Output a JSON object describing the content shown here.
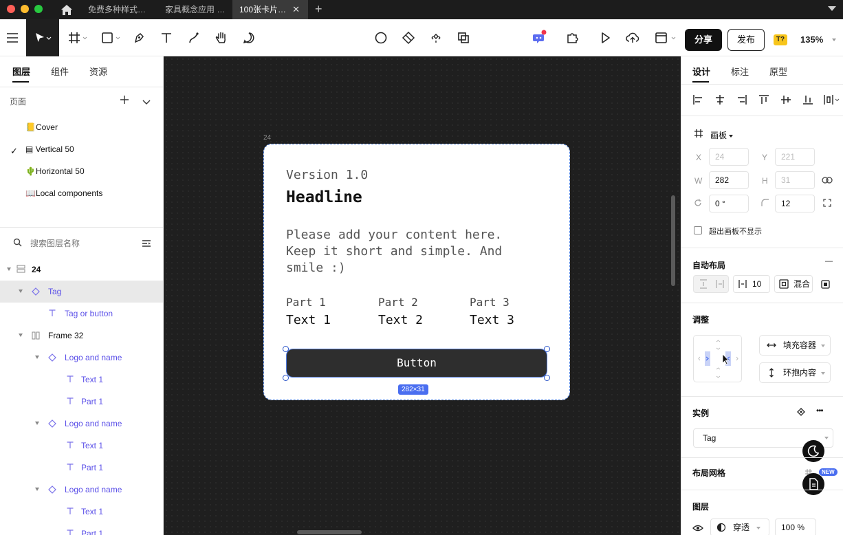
{
  "titlebar": {
    "tabs": [
      {
        "label": "免费多种样式…"
      },
      {
        "label": "家具概念应用 …"
      },
      {
        "label": "100张卡片…"
      }
    ],
    "close": "✕",
    "new_tab": "+"
  },
  "toolbar": {
    "share_label": "分享",
    "publish_label": "发布",
    "font_badge": "T?",
    "zoom": "135%"
  },
  "left": {
    "tabs": [
      "图层",
      "组件",
      "资源"
    ],
    "pages_label": "页面",
    "pages": [
      {
        "label": "📒Cover"
      },
      {
        "label": "▤ Vertical 50"
      },
      {
        "label": "🌵Horizontal 50"
      },
      {
        "label": "📖Local components"
      }
    ],
    "current_mark": "✓",
    "search_placeholder": "搜索图层名称",
    "layers": [
      {
        "label": "24"
      },
      {
        "label": "Tag"
      },
      {
        "label": "Tag or button"
      },
      {
        "label": "Frame 32"
      },
      {
        "label": "Logo and name"
      },
      {
        "label": "Text 1"
      },
      {
        "label": "Part 1"
      },
      {
        "label": "Logo and name"
      },
      {
        "label": "Text 1"
      },
      {
        "label": "Part 1"
      },
      {
        "label": "Logo and name"
      },
      {
        "label": "Text 1"
      },
      {
        "label": "Part 1"
      }
    ]
  },
  "canvas": {
    "frame_number": "24",
    "card": {
      "version": "Version 1.0",
      "headline": "Headline",
      "body": "Please add your content here. Keep it short and simple. And smile :)",
      "parts": [
        {
          "label": "Part 1",
          "text": "Text 1"
        },
        {
          "label": "Part 2",
          "text": "Text 2"
        },
        {
          "label": "Part 3",
          "text": "Text 3"
        }
      ],
      "button": "Button"
    },
    "size_badge": "282×31"
  },
  "right": {
    "tabs": [
      "设计",
      "标注",
      "原型"
    ],
    "frame_type": "画板",
    "x_label": "X",
    "x": "24",
    "y_label": "Y",
    "y": "221",
    "w_label": "W",
    "w": "282",
    "h_label": "H",
    "h": "31",
    "rotation": "0 °",
    "radius": "12",
    "clip_label": "超出画板不显示",
    "auto_layout_title": "自动布局",
    "auto_layout_minus": "—",
    "gap": "10",
    "mix_label": "混合",
    "adjust_title": "调整",
    "fill_container": "填充容器",
    "hug_content": "环抱内容",
    "instance_title": "实例",
    "instance_more": "•••",
    "instance_value": "Tag",
    "layout_grid_title": "布局网格",
    "new_badge": "NEW",
    "layer_title": "图层",
    "blend": "穿透",
    "opacity": "100 %"
  }
}
